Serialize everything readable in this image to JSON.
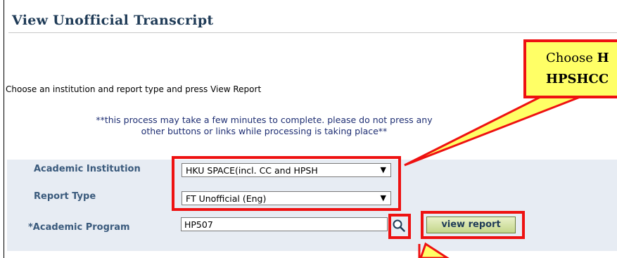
{
  "page": {
    "title": "View Unofficial Transcript",
    "instruction": "Choose an institution and report type and press View Report",
    "warning_line1": "**this process may take a few minutes to complete. please do not press any",
    "warning_line2": "other buttons or links while processing is taking place**"
  },
  "form": {
    "institution_label": "Academic Institution",
    "institution_value": "HKU SPACE(incl. CC and HPSH",
    "report_type_label": "Report Type",
    "report_type_value": "FT Unofficial (Eng)",
    "program_label": "*Academic Program",
    "program_value": "HP507",
    "view_report_label": "view report"
  },
  "callout": {
    "line1_prefix": "Choose ",
    "line1_bold": "H",
    "line2_bold": "HPSHCC"
  },
  "icons": {
    "dropdown": "▼",
    "lookup": "magnifier-icon"
  },
  "colors": {
    "title": "#1f3b57",
    "highlight": "#ee1111",
    "callout_fill": "#ffff66",
    "panel": "#e7ecf3",
    "button": "#c4d68a"
  }
}
